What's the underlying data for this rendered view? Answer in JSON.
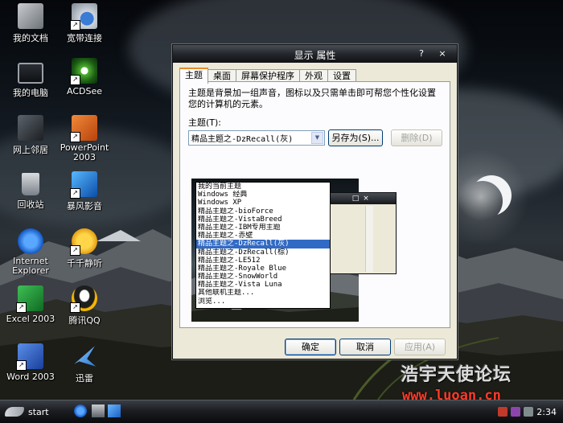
{
  "desktop": {
    "icons": [
      {
        "label": "我的文档",
        "icon": "documents-folder-icon"
      },
      {
        "label": "宽带连接",
        "icon": "broadband-connection-icon"
      },
      {
        "label": "我的电脑",
        "icon": "computer-icon"
      },
      {
        "label": "ACDSee",
        "icon": "acdsee-icon"
      },
      {
        "label": "网上邻居",
        "icon": "network-neighborhood-icon"
      },
      {
        "label": "PowerPoint 2003",
        "icon": "powerpoint-icon"
      },
      {
        "label": "回收站",
        "icon": "recycle-bin-icon"
      },
      {
        "label": "暴风影音",
        "icon": "stormplayer-icon"
      },
      {
        "label": "Internet Explorer",
        "icon": "internet-explorer-icon"
      },
      {
        "label": "千千静听",
        "icon": "ttplayer-icon"
      },
      {
        "label": "Excel 2003",
        "icon": "excel-icon"
      },
      {
        "label": "腾讯QQ",
        "icon": "qq-icon"
      },
      {
        "label": "Word 2003",
        "icon": "word-icon"
      },
      {
        "label": "迅雷",
        "icon": "thunder-icon"
      }
    ]
  },
  "dialog": {
    "title": "显示 属性",
    "help_label": "?",
    "close_label": "×",
    "tabs": [
      "主题",
      "桌面",
      "屏幕保护程序",
      "外观",
      "设置"
    ],
    "description": "主题是背景加一组声音，图标以及只需单击即可帮您个性化设置您的计算机的元素。",
    "theme_label": "主题(T):",
    "theme_value": "精品主题之-DzRecall(灰)",
    "save_as_label": "另存为(S)...",
    "delete_label": "删除(D)",
    "theme_options": [
      "我的当前主题",
      "Windows 经典",
      "Windows XP",
      "精品主题之-bioForce",
      "精品主题之-VistaBreed",
      "精品主题之-IBM专用主题",
      "精品主题之-赤壁",
      "精品主题之-DzRecall(灰)",
      "精品主题之-DzRecall(棕)",
      "精品主题之-LE512",
      "精品主题之-Royale Blue",
      "精品主题之-SnowWorld",
      "精品主题之-Vista Luna",
      "其他联机主题...",
      "浏览..."
    ],
    "selected_index": 7,
    "ok_label": "确定",
    "cancel_label": "取消",
    "apply_label": "应用(A)"
  },
  "taskbar": {
    "start_label": "start",
    "clock": "2:34"
  },
  "watermark": {
    "site_name": "浩宇天使论坛",
    "url": "www.luoan.cn"
  },
  "colors": {
    "selection": "#316ac5",
    "tab_highlight": "#e68b2c",
    "watermark_url": "#ff3a2a"
  }
}
